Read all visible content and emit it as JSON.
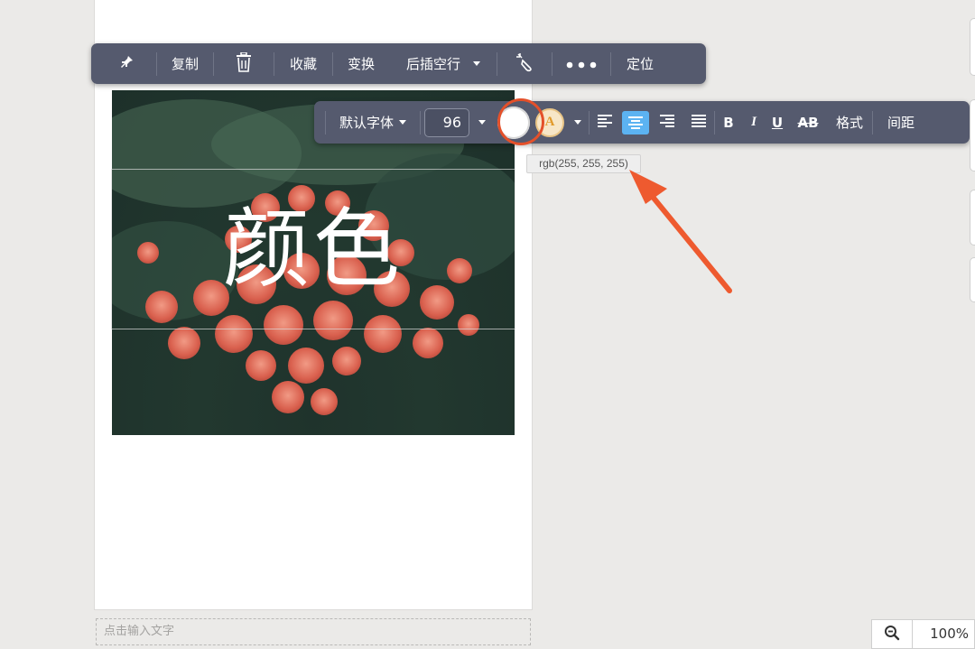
{
  "object_toolbar": {
    "pin_icon": "pin-icon",
    "copy_label": "复制",
    "delete_icon": "trash-icon",
    "collect_label": "收藏",
    "transform_label": "变换",
    "insert_label": "后插空行",
    "magic_icon": "magic-wand-icon",
    "more_icon": "more-dots-icon",
    "position_label": "定位"
  },
  "text_toolbar": {
    "font_label": "默认字体",
    "font_size": "96",
    "text_color": "#ffffff",
    "text_color_glyph": "A",
    "align_active": "center",
    "bold_label": "B",
    "italic_label": "I",
    "underline_label": "U",
    "strike_label": "AB",
    "format_label": "格式",
    "spacing_label": "间距"
  },
  "tooltip": {
    "text": "rgb(255, 255, 255)"
  },
  "canvas": {
    "overlay_text": "颜色",
    "input_placeholder": "点击输入文字"
  },
  "zoom": {
    "icon": "zoom-out-icon",
    "value": "100%"
  },
  "colors": {
    "toolbar_bg": "#555a6e",
    "highlight_ring": "#e4502a",
    "active_align": "#5cb3f2",
    "arrow": "#ee5a2f"
  }
}
